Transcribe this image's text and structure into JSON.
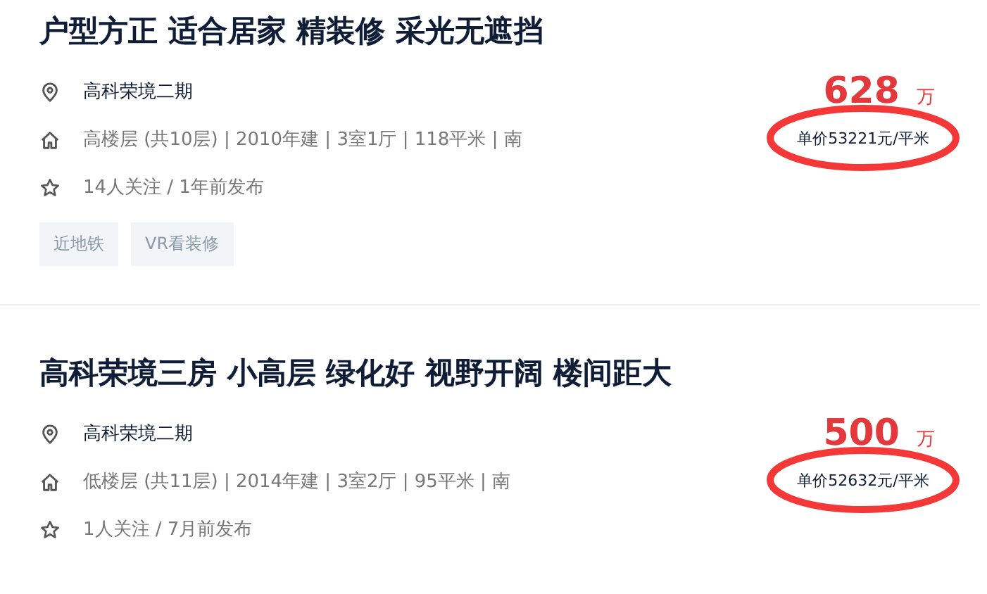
{
  "listings": [
    {
      "title": "户型方正 适合居家 精装修 采光无遮挡",
      "community": "高科荣境二期",
      "details": "高楼层 (共10层) | 2010年建 | 3室1厅 | 118平米 | 南",
      "followers": "14人关注 / 1年前发布",
      "tags": [
        "近地铁",
        "VR看装修"
      ],
      "price": "628",
      "price_unit": "万",
      "unit_price": "单价53221元/平米",
      "circled": true
    },
    {
      "title": "高科荣境三房 小高层 绿化好 视野开阔 楼间距大",
      "community": "高科荣境二期",
      "details": "低楼层 (共11层) | 2014年建 | 3室2厅 | 95平米 | 南",
      "followers": "1人关注 / 7月前发布",
      "price": "500",
      "price_unit": "万",
      "unit_price": "单价52632元/平米",
      "circled": true
    }
  ]
}
